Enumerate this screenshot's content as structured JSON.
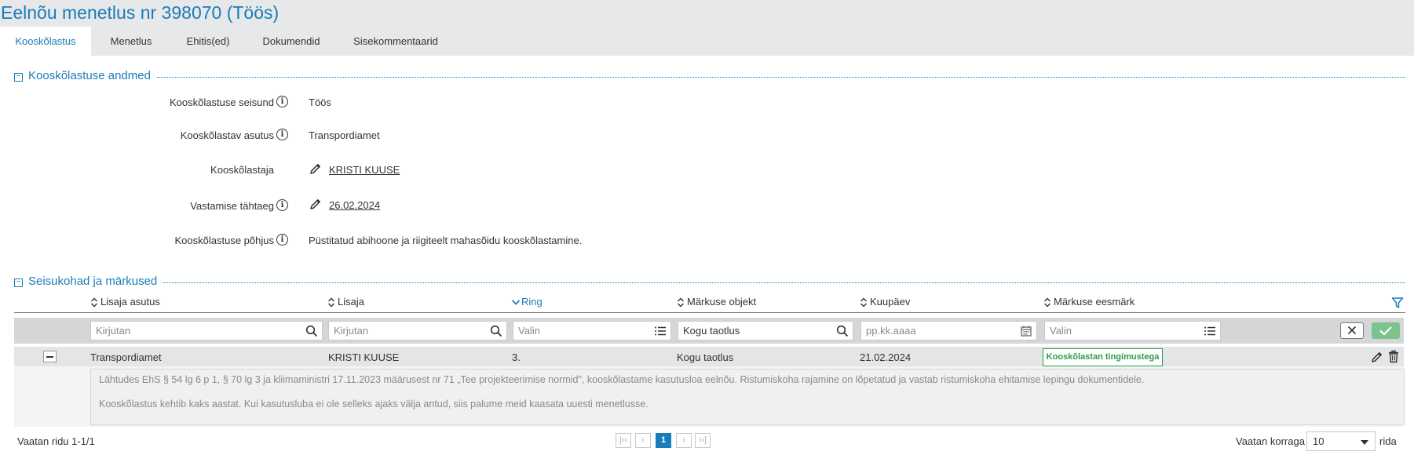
{
  "page_title": "Eelnõu menetlus nr 398070 (Töös)",
  "tabs": [
    "Kooskõlastus",
    "Menetlus",
    "Ehitis(ed)",
    "Dokumendid",
    "Sisekommentaarid"
  ],
  "section1": {
    "title": "Kooskõlastuse andmed",
    "fields": {
      "seisund": {
        "label": "Kooskõlastuse seisund",
        "value": "Töös"
      },
      "asutus": {
        "label": "Kooskõlastav asutus",
        "value": "Transpordiamet"
      },
      "kooskolastaja": {
        "label": "Kooskõlastaja",
        "value": "KRISTI KUUSE"
      },
      "tahtaeg": {
        "label": "Vastamise tähtaeg",
        "value": "26.02.2024"
      },
      "pohjus": {
        "label": "Kooskõlastuse põhjus",
        "value": "Püstitatud abihoone ja riigiteelt mahasõidu kooskõlastamine."
      }
    }
  },
  "section2": {
    "title": "Seisukohad ja märkused",
    "columns": [
      "Lisaja asutus",
      "Lisaja",
      "Ring",
      "Märkuse objekt",
      "Kuupäev",
      "Märkuse eesmärk"
    ],
    "filters": {
      "lisaja_asutus": {
        "placeholder": "Kirjutan"
      },
      "lisaja": {
        "placeholder": "Kirjutan"
      },
      "ring": {
        "placeholder": "Valin"
      },
      "markuse_objekt": {
        "value": "Kogu taotlus"
      },
      "kuupaev": {
        "placeholder": "pp.kk.aaaa"
      },
      "eesmark": {
        "placeholder": "Valin"
      }
    },
    "row": {
      "lisaja_asutus": "Transpordiamet",
      "lisaja": "KRISTI KUUSE",
      "ring": "3.",
      "markuse_objekt": "Kogu taotlus",
      "kuupaev": "21.02.2024",
      "eesmark": "Kooskõlastan tingimustega",
      "detail_line1": "Lähtudes EhS § 54 lg 6 p 1, § 70 lg 3 ja kliimaministri 17.11.2023 määrusest nr 71 „Tee projekteerimise normid\", kooskõlastame kasutusloa eelnõu. Ristumiskoha rajamine on lõpetatud ja vastab ristumiskoha ehitamise lepingu dokumentidele.",
      "detail_line2": "Kooskõlastus kehtib kaks aastat. Kui kasutusluba ei ole selleks ajaks välja antud, siis palume meid kaasata uuesti menetlusse."
    }
  },
  "footer": {
    "rows_info": "Vaatan ridu 1-1/1",
    "pages": [
      "1"
    ],
    "per_page_label": "Vaatan korraga",
    "per_page_value": "10",
    "per_page_suffix": "rida"
  },
  "colors": {
    "accent": "#1a7cb8",
    "success": "#2e9a4a",
    "confirm": "#7cc48d"
  }
}
